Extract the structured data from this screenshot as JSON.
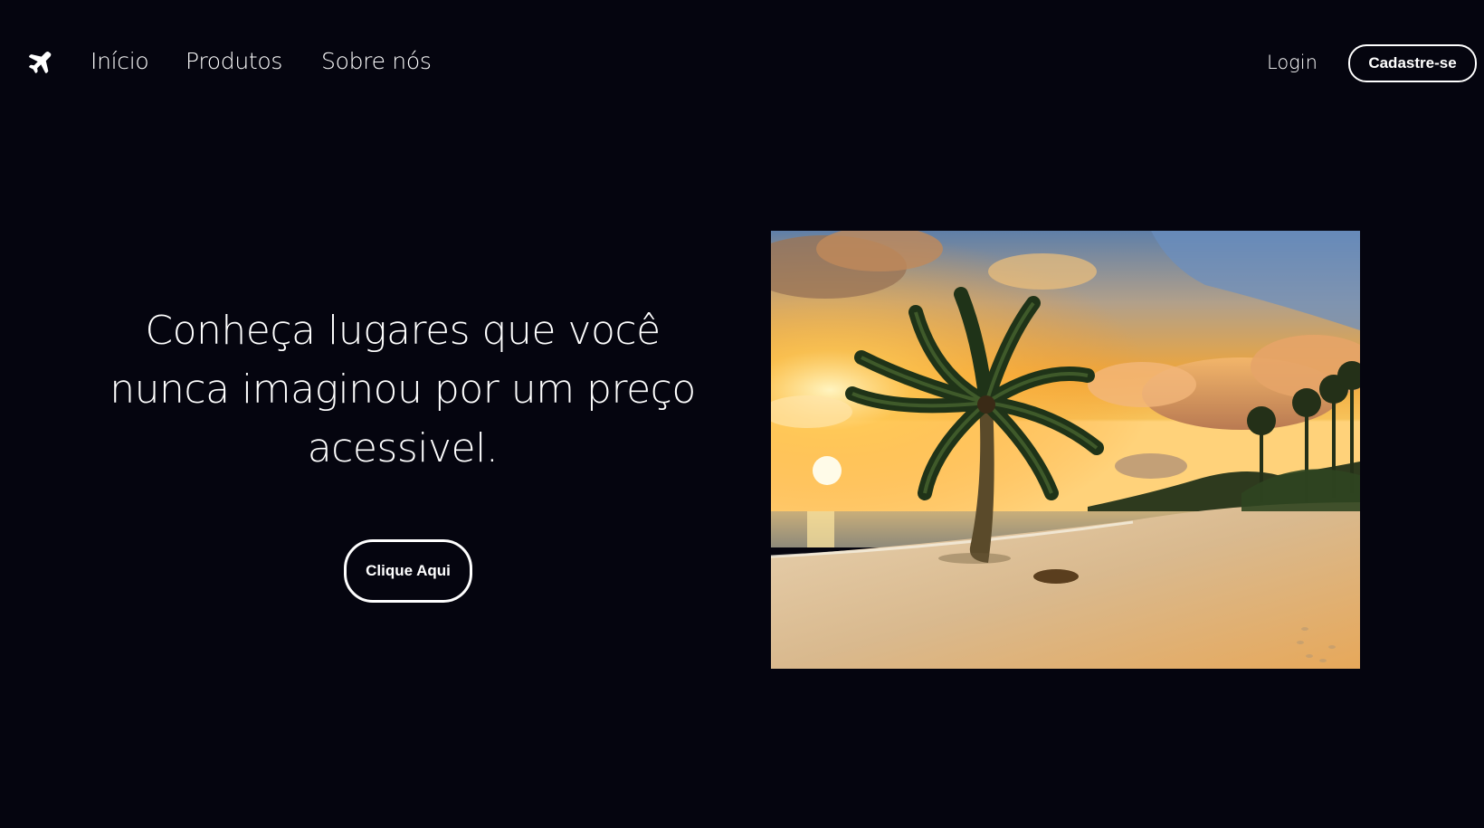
{
  "nav": {
    "logo_icon": "airplane-icon",
    "links": [
      {
        "label": "Início"
      },
      {
        "label": "Produtos"
      },
      {
        "label": "Sobre nós"
      }
    ],
    "login_label": "Login",
    "signup_label": "Cadastre-se"
  },
  "hero": {
    "headline": "Conheça lugares que você nunca imaginou por um preço acessivel.",
    "cta_label": "Clique Aqui",
    "image_subject": "tropical beach sunset with palm tree"
  },
  "colors": {
    "background": "#05050f",
    "text": "#ffffff",
    "button_border": "#ffffff"
  }
}
